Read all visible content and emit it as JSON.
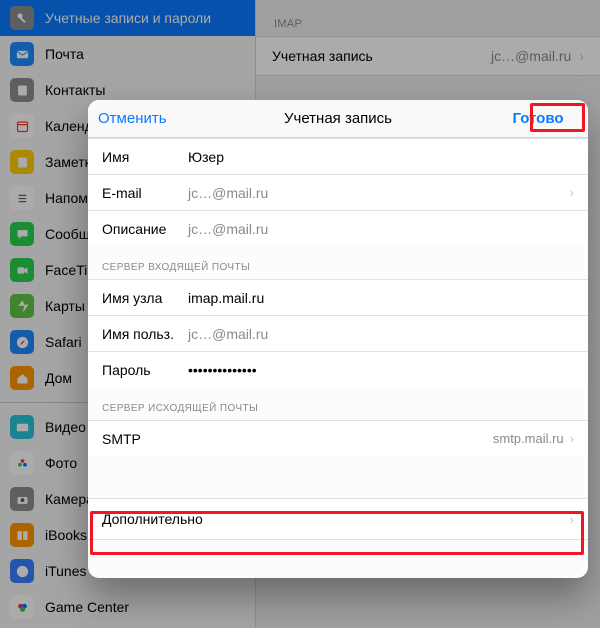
{
  "sidebar": {
    "items": [
      {
        "label": "Учетные записи и пароли",
        "icon": "key",
        "bg": "#8e8e93",
        "selected": true
      },
      {
        "label": "Почта",
        "icon": "mail",
        "bg": "#1f8bff"
      },
      {
        "label": "Контакты",
        "icon": "contacts",
        "bg": "#8e8e93"
      },
      {
        "label": "Календарь",
        "icon": "calendar",
        "bg": "#ffffff"
      },
      {
        "label": "Заметки",
        "icon": "notes",
        "bg": "#ffcc00"
      },
      {
        "label": "Напоминания",
        "icon": "reminders",
        "bg": "#ffffff"
      },
      {
        "label": "Сообщения",
        "icon": "messages",
        "bg": "#29d24b"
      },
      {
        "label": "FaceTime",
        "icon": "facetime",
        "bg": "#29d24b"
      },
      {
        "label": "Карты",
        "icon": "maps",
        "bg": "#62c544"
      },
      {
        "label": "Safari",
        "icon": "safari",
        "bg": "#1f8bff"
      },
      {
        "label": "Дом",
        "icon": "home",
        "bg": "#ff9500"
      }
    ],
    "items2": [
      {
        "label": "Видео",
        "icon": "video",
        "bg": "#27c7d8"
      },
      {
        "label": "Фото",
        "icon": "photos",
        "bg": "#ffffff"
      },
      {
        "label": "Камера",
        "icon": "camera",
        "bg": "#8e8e93"
      },
      {
        "label": "iBooks",
        "icon": "ibooks",
        "bg": "#ff9500"
      },
      {
        "label": "iTunes Connect",
        "icon": "itunes",
        "bg": "#3880ff"
      },
      {
        "label": "Game Center",
        "icon": "gamecenter",
        "bg": "#ffffff"
      }
    ]
  },
  "detail": {
    "section": "IMAP",
    "account_label": "Учетная запись",
    "account_value": "jс…@mail.ru"
  },
  "sheet": {
    "cancel": "Отменить",
    "title": "Учетная запись",
    "done": "Готово",
    "fields": {
      "name_label": "Имя",
      "name_value": "Юзер",
      "email_label": "E-mail",
      "email_value": "jс…@mail.ru",
      "desc_label": "Описание",
      "desc_value": "jс…@mail.ru"
    },
    "incoming_header": "СЕРВЕР ВХОДЯЩЕЙ ПОЧТЫ",
    "incoming": {
      "host_label": "Имя узла",
      "host_value": "imap.mail.ru",
      "user_label": "Имя польз.",
      "user_value": "jс…@mail.ru",
      "pass_label": "Пароль",
      "pass_value": "••••••••••••••"
    },
    "outgoing_header": "СЕРВЕР ИСХОДЯЩЕЙ ПОЧТЫ",
    "smtp_label": "SMTP",
    "smtp_value": "smtp.mail.ru",
    "advanced": "Дополнительно"
  }
}
